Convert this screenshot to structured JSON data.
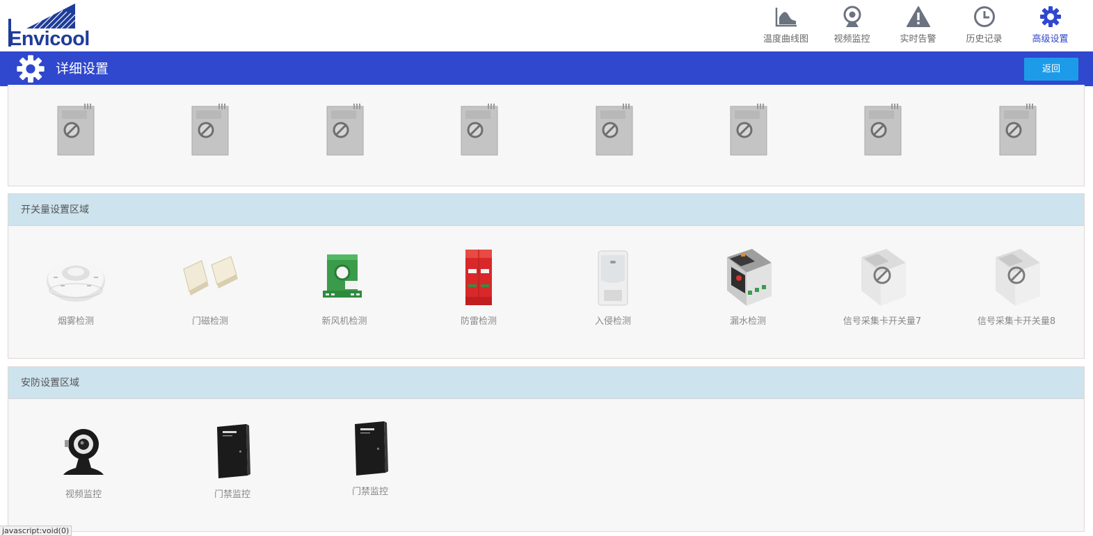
{
  "brand": {
    "logo_text": "Envicool"
  },
  "nav": [
    {
      "label": "温度曲线图",
      "icon": "area-chart-icon",
      "active": false
    },
    {
      "label": "视频监控",
      "icon": "webcam-icon",
      "active": false
    },
    {
      "label": "实时告警",
      "icon": "warning-icon",
      "active": false
    },
    {
      "label": "历史记录",
      "icon": "clock-icon",
      "active": false
    },
    {
      "label": "高级设置",
      "icon": "gear-icon",
      "active": true
    }
  ],
  "titlebar": {
    "title": "详细设置",
    "back_label": "返回"
  },
  "top_row": {
    "count": 8
  },
  "switch_section": {
    "heading": "开关量设置区域",
    "items": [
      {
        "label": "烟雾检测",
        "icon": "smoke-detector-icon"
      },
      {
        "label": "门磁检测",
        "icon": "door-magnet-icon"
      },
      {
        "label": "新风机检测",
        "icon": "current-sensor-icon"
      },
      {
        "label": "防雷检测",
        "icon": "surge-protector-icon"
      },
      {
        "label": "入侵检测",
        "icon": "pir-sensor-icon"
      },
      {
        "label": "漏水检测",
        "icon": "leak-detector-icon"
      },
      {
        "label": "信号采集卡开关量7",
        "icon": "signal-card-disabled-icon"
      },
      {
        "label": "信号采集卡开关量8",
        "icon": "signal-card-disabled-icon"
      }
    ]
  },
  "security_section": {
    "heading": "安防设置区域",
    "items": [
      {
        "label": "视频监控",
        "icon": "webcam-icon"
      },
      {
        "label": "门禁监控",
        "icon": "access-control-box-icon"
      },
      {
        "label": "门禁监控",
        "icon": "access-control-box-icon"
      }
    ]
  },
  "status_bar": {
    "url": "javascript:void(0)"
  },
  "colors": {
    "brand_blue": "#2f48ce",
    "button_blue": "#1e9be8",
    "section_head": "#cde3ee"
  }
}
